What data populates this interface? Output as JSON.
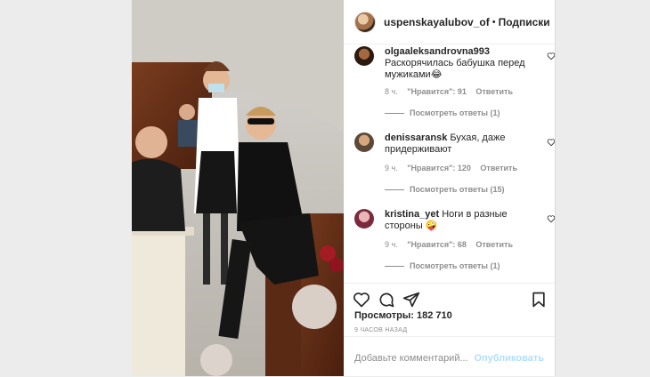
{
  "post": {
    "username": "uspenskayalubov_of",
    "separator": "•",
    "follow_label": "Подписки",
    "views_label": "Просмотры: 182 710",
    "time_ago": "9 ЧАСОВ НАЗАД",
    "add_comment_placeholder": "Добавьте комментарий...",
    "publish_label": "Опубликовать"
  },
  "comments": [
    {
      "username": "olgaaleksandrovna993",
      "text": "Раскорячилась бабушка перед мужиками😂",
      "time": "8 ч.",
      "likes": "\"Нравится\": 91",
      "reply": "Ответить",
      "view_replies": "Посмотреть ответы (1)"
    },
    {
      "username": "denissaransk",
      "text": "Бухая, даже придерживают",
      "time": "9 ч.",
      "likes": "\"Нравится\": 120",
      "reply": "Ответить",
      "view_replies": "Посмотреть ответы (15)"
    },
    {
      "username": "kristina_yet",
      "text": "Ноги в разные стороны 🤪",
      "time": "9 ч.",
      "likes": "\"Нравится\": 68",
      "reply": "Ответить",
      "view_replies": "Посмотреть ответы (1)"
    }
  ],
  "icons": [
    "heart-icon",
    "comment-icon",
    "share-icon",
    "bookmark-icon",
    "like-comment-icon"
  ],
  "colors": {
    "text": "#262626",
    "muted": "#8e8e8e",
    "publish_disabled": "#b2dffc",
    "border": "#dbdbdb"
  }
}
